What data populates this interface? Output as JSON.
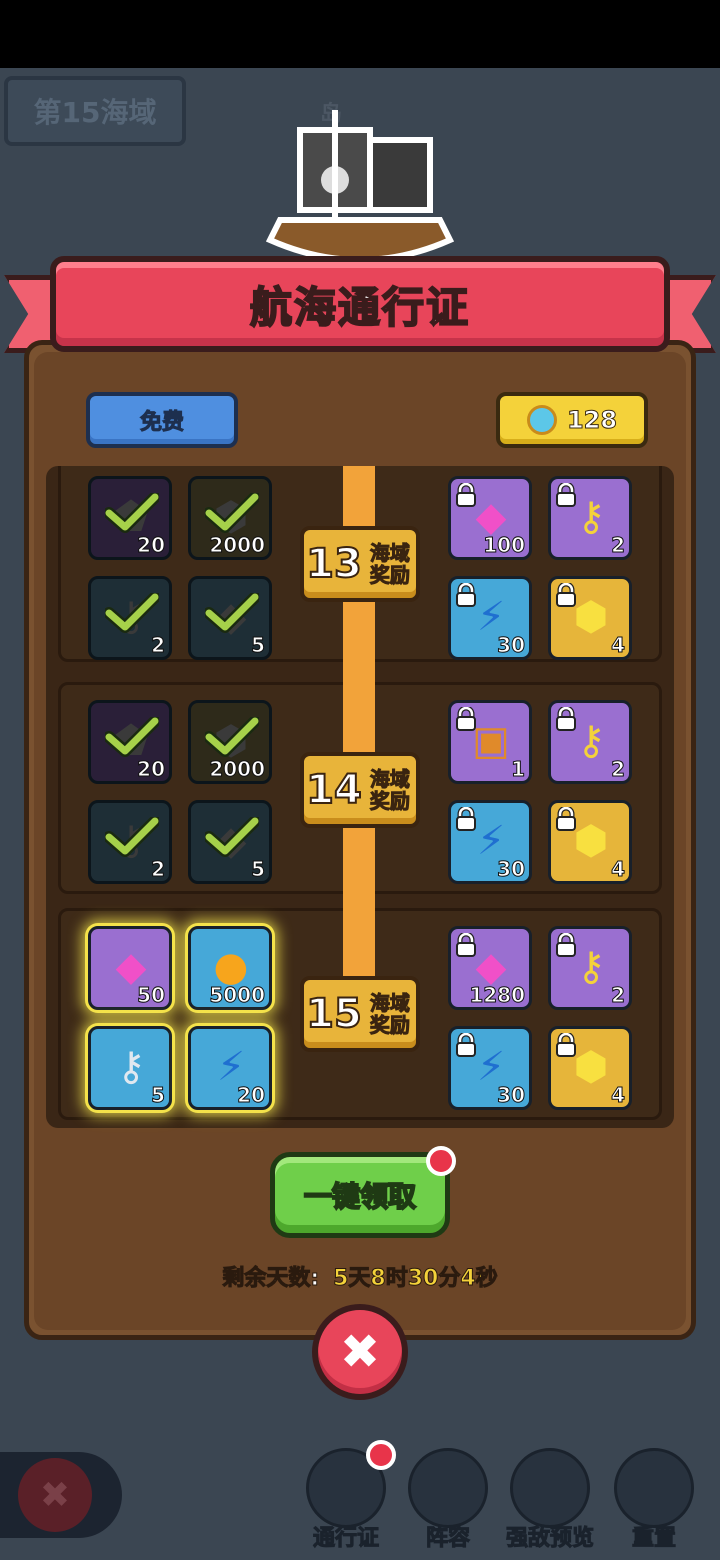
{
  "header": {
    "sea_zone": "第15海域",
    "island_label": "岛"
  },
  "pass": {
    "title": "航海通行证",
    "free_label": "免费",
    "premium_gems": "128",
    "claim_all_label": "一键领取",
    "remaining_label": "剩余天数:",
    "remaining_value": "5天8时30分4秒"
  },
  "levels": [
    {
      "num": "13",
      "text": "海域奖励",
      "free": [
        {
          "icon": "purple-crystal-icon",
          "qty": "20"
        },
        {
          "icon": "gold-ore-icon",
          "qty": "2000"
        },
        {
          "icon": "key-icon",
          "qty": "2"
        },
        {
          "icon": "blue-energy-icon",
          "qty": "5"
        }
      ],
      "premium": [
        {
          "icon": "pink-gem-icon",
          "qty": "100"
        },
        {
          "icon": "gold-key-icon",
          "qty": "2"
        },
        {
          "icon": "lightning-icon",
          "qty": "30"
        },
        {
          "icon": "gold-hex-coin-icon",
          "qty": "4"
        }
      ]
    },
    {
      "num": "14",
      "text": "海域奖励",
      "free": [
        {
          "icon": "purple-crystal-icon",
          "qty": "20"
        },
        {
          "icon": "gold-ore-icon",
          "qty": "2000"
        },
        {
          "icon": "key-icon",
          "qty": "2"
        },
        {
          "icon": "blue-energy-icon",
          "qty": "5"
        }
      ],
      "premium": [
        {
          "icon": "treasure-chest-icon",
          "qty": "1"
        },
        {
          "icon": "gold-key-icon",
          "qty": "2"
        },
        {
          "icon": "lightning-icon",
          "qty": "30"
        },
        {
          "icon": "gold-hex-coin-icon",
          "qty": "4"
        }
      ]
    },
    {
      "num": "15",
      "text": "海域奖励",
      "free": [
        {
          "icon": "pink-gem-icon",
          "qty": "50"
        },
        {
          "icon": "gold-coin-icon",
          "qty": "5000"
        },
        {
          "icon": "silver-key-icon",
          "qty": "5"
        },
        {
          "icon": "lightning-icon",
          "qty": "20"
        }
      ],
      "premium": [
        {
          "icon": "pink-gem-icon",
          "qty": "1280"
        },
        {
          "icon": "gold-key-icon",
          "qty": "2"
        },
        {
          "icon": "lightning-icon",
          "qty": "30"
        },
        {
          "icon": "gold-hex-coin-icon",
          "qty": "4"
        }
      ]
    }
  ],
  "bottom_nav": [
    {
      "label": "通行证",
      "icon": "passport-icon"
    },
    {
      "label": "阵容",
      "icon": "lineup-icon"
    },
    {
      "label": "强敌预览",
      "icon": "magnifier-icon"
    },
    {
      "label": "重置",
      "icon": "reset-icon"
    }
  ]
}
